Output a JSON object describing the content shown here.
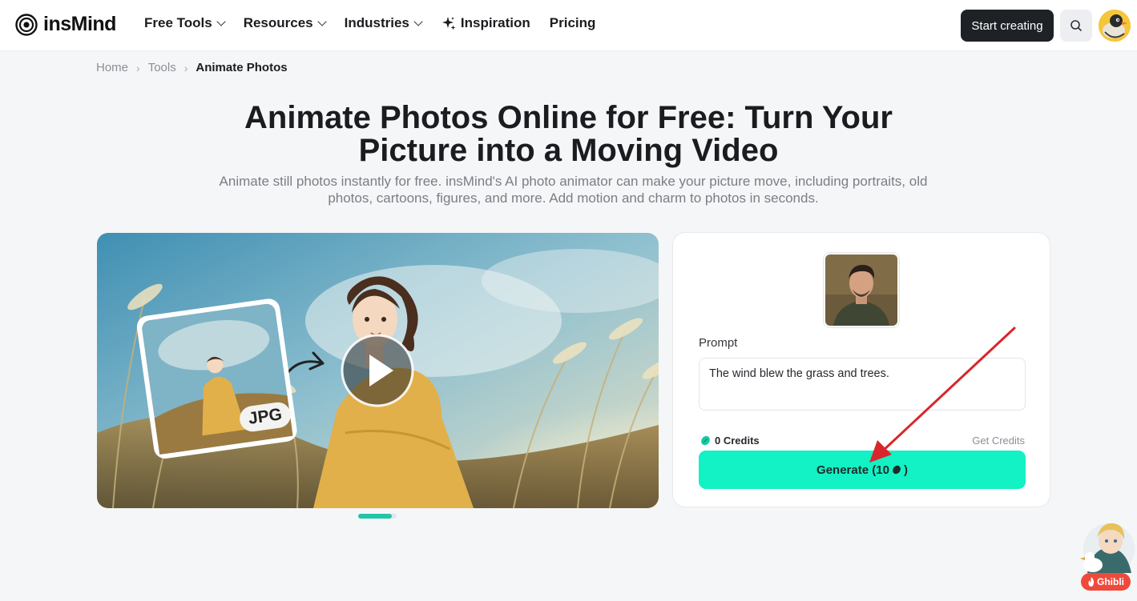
{
  "header": {
    "logo_text": "insMind",
    "nav": [
      {
        "label": "Free Tools",
        "dropdown": true
      },
      {
        "label": "Resources",
        "dropdown": true
      },
      {
        "label": "Industries",
        "dropdown": true
      },
      {
        "label": "Inspiration",
        "icon": "sparkle-icon"
      },
      {
        "label": "Pricing"
      }
    ],
    "start_button": "Start creating",
    "search_icon": "search-icon"
  },
  "breadcrumb": {
    "items": [
      "Home",
      "Tools"
    ],
    "current": "Animate Photos",
    "separator": "›"
  },
  "hero": {
    "title_line1": "Animate Photos Online for Free: Turn Your",
    "title_line2": "Picture into a Moving Video",
    "subtitle_line1": "Animate still photos instantly for free. insMind's AI photo animator can make your picture move, including portraits, old",
    "subtitle_line2": "photos, cartoons, figures, and more. Add motion and charm to photos in seconds."
  },
  "media": {
    "badge": "JPG",
    "play_icon": "play-icon",
    "slide_index": 1,
    "slide_count": 1
  },
  "generator": {
    "prompt_label": "Prompt",
    "prompt_value": "The wind blew the grass and trees.",
    "credits_label": "0 Credits",
    "get_credits": "Get Credits",
    "generate_label": "Generate (10",
    "generate_suffix": ")",
    "credit_icon": "bean-icon"
  },
  "floating_badge": {
    "label": "Ghibli",
    "icon": "fire-icon"
  },
  "colors": {
    "accent": "#12f2c4",
    "slider": "#22c6a6",
    "dark_button": "#1e2126",
    "badge": "#ee4a3c",
    "annotation_arrow": "#d9262c"
  }
}
